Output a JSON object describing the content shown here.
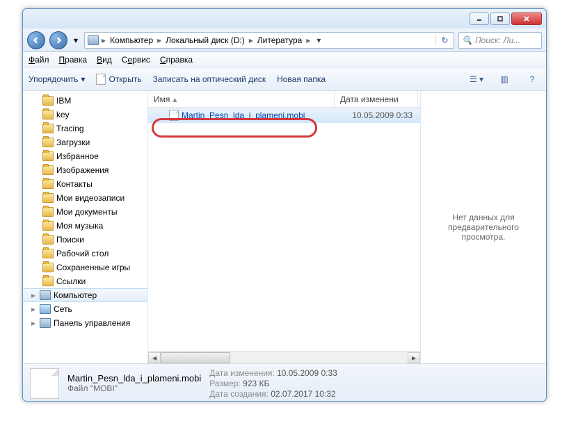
{
  "titlebar": {},
  "breadcrumbs": {
    "root": "Компьютер",
    "drive": "Локальный диск (D:)",
    "folder": "Литература"
  },
  "search": {
    "placeholder": "Поиск: Ли..."
  },
  "menu": {
    "file": "Файл",
    "edit": "Правка",
    "view": "Вид",
    "tools": "Сервис",
    "help": "Справка"
  },
  "toolbar": {
    "organize": "Упорядочить",
    "open": "Открыть",
    "burn": "Записать на оптический диск",
    "newfolder": "Новая папка"
  },
  "columns": {
    "name": "Имя",
    "modified": "Дата изменени"
  },
  "tree": {
    "items": [
      {
        "label": "IBM",
        "icon": "folder"
      },
      {
        "label": "key",
        "icon": "folder"
      },
      {
        "label": "Tracing",
        "icon": "folder"
      },
      {
        "label": "Загрузки",
        "icon": "folder"
      },
      {
        "label": "Избранное",
        "icon": "folder"
      },
      {
        "label": "Изображения",
        "icon": "folder"
      },
      {
        "label": "Контакты",
        "icon": "folder"
      },
      {
        "label": "Мои видеозаписи",
        "icon": "folder"
      },
      {
        "label": "Мои документы",
        "icon": "folder"
      },
      {
        "label": "Моя музыка",
        "icon": "folder"
      },
      {
        "label": "Поиски",
        "icon": "folder"
      },
      {
        "label": "Рабочий стол",
        "icon": "folder"
      },
      {
        "label": "Сохраненные игры",
        "icon": "folder"
      },
      {
        "label": "Ссылки",
        "icon": "folder"
      }
    ],
    "computer": "Компьютер",
    "network": "Сеть",
    "controlpanel": "Панель управления"
  },
  "files": [
    {
      "name": "Martin_Pesn_lda_i_plameni.mobi",
      "modified": "10.05.2009 0:33"
    }
  ],
  "preview": {
    "empty": "Нет данных для предварительного просмотра."
  },
  "details": {
    "filename": "Martin_Pesn_lda_i_plameni.mobi",
    "filetype": "Файл \"MOBI\"",
    "modified_k": "Дата изменения:",
    "modified_v": "10.05.2009 0:33",
    "size_k": "Размер:",
    "size_v": "923 КБ",
    "created_k": "Дата создания:",
    "created_v": "02.07.2017 10:32"
  }
}
